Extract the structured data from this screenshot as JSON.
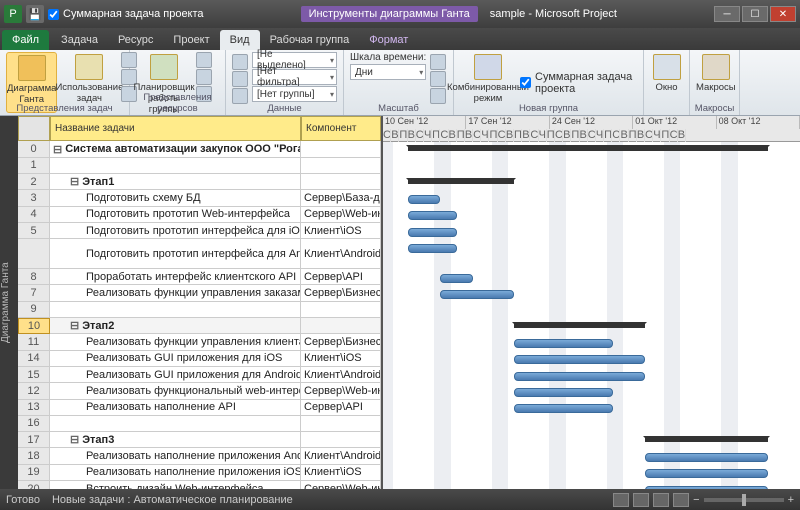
{
  "titlebar": {
    "checkbox_label": "Суммарная задача проекта",
    "contextual_title": "Инструменты диаграммы Ганта",
    "doc_title": "sample - Microsoft Project"
  },
  "tabs": {
    "file": "Файл",
    "task": "Задача",
    "resource": "Ресурс",
    "project": "Проект",
    "view": "Вид",
    "team": "Рабочая группа",
    "format": "Формат"
  },
  "ribbon": {
    "g1": {
      "btn1": "Диаграмма Ганта",
      "btn2": "Использование задач",
      "label": "Представления задач"
    },
    "g2": {
      "btn1": "Планировщик работы группы",
      "label": "Представления ресурсов"
    },
    "g3": {
      "c1": "[Не выделено]",
      "c2": "[Нет фильтра]",
      "c3": "[Нет группы]",
      "label": "Данные"
    },
    "g4": {
      "scale_lbl": "Шкала времени:",
      "scale_val": "Дни",
      "label": "Масштаб"
    },
    "g5": {
      "btn": "Комбинированный режим",
      "chk": "Суммарная задача проекта",
      "label": "Новая группа"
    },
    "g6": {
      "btn": "Окно",
      "label": ""
    },
    "g7": {
      "btn": "Макросы",
      "label": "Макросы"
    }
  },
  "grid": {
    "col_name": "Название задачи",
    "col_comp": "Компонент",
    "sidebar": "Диаграмма Ганта",
    "rows": [
      {
        "id": "0",
        "name": "Система автоматизации закупок ООО \"Рога и",
        "comp": "",
        "bold": true,
        "lvl": 0,
        "exp": "-"
      },
      {
        "id": "1",
        "name": "",
        "comp": "",
        "lvl": 0
      },
      {
        "id": "2",
        "name": "Этап1",
        "comp": "",
        "bold": true,
        "lvl": 1,
        "exp": "-"
      },
      {
        "id": "3",
        "name": "Подготовить схему БД",
        "comp": "Сервер\\База-да",
        "lvl": 2
      },
      {
        "id": "4",
        "name": "Подготовить прототип Web-интерфейса",
        "comp": "Сервер\\Web-ин",
        "lvl": 2
      },
      {
        "id": "5",
        "name": "Подготовить прототип интерфейса для iOS",
        "comp": "Клиент\\iOS",
        "lvl": 2
      },
      {
        "id": "",
        "name": "Подготовить прототип интерфейса для Android",
        "comp": "Клиент\\Android",
        "lvl": 2,
        "tall": true
      },
      {
        "id": "8",
        "name": "Проработать интерфейс клиентского API",
        "comp": "Сервер\\API",
        "lvl": 2
      },
      {
        "id": "7",
        "name": "Реализовать функции управления заказами",
        "comp": "Сервер\\Бизнес-",
        "lvl": 2
      },
      {
        "id": "9",
        "name": "",
        "comp": "",
        "lvl": 0
      },
      {
        "id": "10",
        "name": "Этап2",
        "comp": "",
        "bold": true,
        "lvl": 1,
        "exp": "-",
        "sel": true
      },
      {
        "id": "11",
        "name": "Реализовать функции управления клиентами",
        "comp": "Сервер\\Бизнес-",
        "lvl": 2
      },
      {
        "id": "14",
        "name": "Реализовать GUI приложения для iOS",
        "comp": "Клиент\\iOS",
        "lvl": 2
      },
      {
        "id": "15",
        "name": "Реализовать GUI приложения для Android",
        "comp": "Клиент\\Android",
        "lvl": 2
      },
      {
        "id": "12",
        "name": "Реализовать функциональный web-интерфейс",
        "comp": "Сервер\\Web-ин",
        "lvl": 2
      },
      {
        "id": "13",
        "name": "Реализовать наполнение API",
        "comp": "Сервер\\API",
        "lvl": 2
      },
      {
        "id": "16",
        "name": "",
        "comp": "",
        "lvl": 0
      },
      {
        "id": "17",
        "name": "Этап3",
        "comp": "",
        "bold": true,
        "lvl": 1,
        "exp": "-"
      },
      {
        "id": "18",
        "name": "Реализовать наполнение приложения Andro",
        "comp": "Клиент\\Android",
        "lvl": 2
      },
      {
        "id": "19",
        "name": "Реализовать наполнение приложения iOS",
        "comp": "Клиент\\iOS",
        "lvl": 2
      },
      {
        "id": "20",
        "name": "Встроить дизайн Web-интерфейса",
        "comp": "Сервер\\Web-ин",
        "lvl": 2
      }
    ]
  },
  "gantt": {
    "weeks": [
      "10 Сен '12",
      "17 Сен '12",
      "24 Сен '12",
      "01 Окт '12",
      "08 Окт '12"
    ],
    "days": "СВПВСЧПСВПВСЧПСВПВСЧПСВПВСЧПСВПВСЧПСВ"
  },
  "statusbar": {
    "ready": "Готово",
    "mode": "Новые задачи : Автоматическое планирование"
  },
  "chart_data": {
    "type": "gantt",
    "time_unit": "days",
    "start_date": "2012-09-08",
    "tasks": [
      {
        "row": 0,
        "type": "summary",
        "start": 3,
        "dur": 44
      },
      {
        "row": 2,
        "type": "summary",
        "start": 3,
        "dur": 13
      },
      {
        "row": 3,
        "type": "bar",
        "start": 3,
        "dur": 4
      },
      {
        "row": 4,
        "type": "bar",
        "start": 3,
        "dur": 6
      },
      {
        "row": 5,
        "type": "bar",
        "start": 3,
        "dur": 6
      },
      {
        "row": 6,
        "type": "bar",
        "start": 3,
        "dur": 6
      },
      {
        "row": 7,
        "type": "bar",
        "start": 7,
        "dur": 4
      },
      {
        "row": 8,
        "type": "bar",
        "start": 7,
        "dur": 9
      },
      {
        "row": 10,
        "type": "summary",
        "start": 16,
        "dur": 16
      },
      {
        "row": 11,
        "type": "bar",
        "start": 16,
        "dur": 12
      },
      {
        "row": 12,
        "type": "bar",
        "start": 16,
        "dur": 16
      },
      {
        "row": 13,
        "type": "bar",
        "start": 16,
        "dur": 16
      },
      {
        "row": 14,
        "type": "bar",
        "start": 16,
        "dur": 12
      },
      {
        "row": 15,
        "type": "bar",
        "start": 16,
        "dur": 12
      },
      {
        "row": 17,
        "type": "summary",
        "start": 32,
        "dur": 15
      },
      {
        "row": 18,
        "type": "bar",
        "start": 32,
        "dur": 15
      },
      {
        "row": 19,
        "type": "bar",
        "start": 32,
        "dur": 15
      },
      {
        "row": 20,
        "type": "bar",
        "start": 32,
        "dur": 15
      }
    ],
    "dependencies": [
      {
        "from": 3,
        "to": 7
      },
      {
        "from": 3,
        "to": 8
      },
      {
        "from": 8,
        "to": 11
      },
      {
        "from": 11,
        "to": 14
      },
      {
        "from": 12,
        "to": 18
      },
      {
        "from": 13,
        "to": 19
      }
    ]
  }
}
